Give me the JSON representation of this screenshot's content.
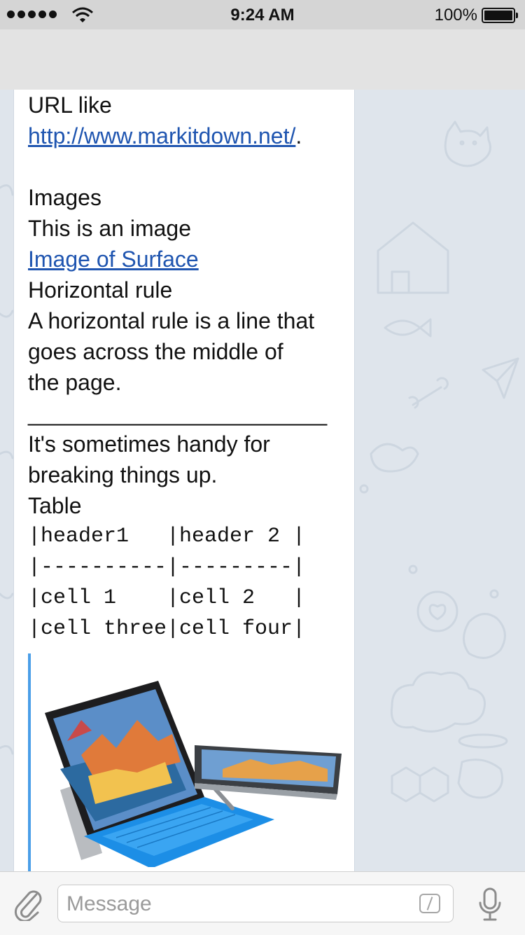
{
  "status_bar": {
    "time": "9:24 AM",
    "battery": "100%",
    "icons": [
      "signal-dots-icon",
      "wifi-icon",
      "battery-icon"
    ]
  },
  "message": {
    "url_prefix": "URL like",
    "url_link": "http://www.markitdown.net/",
    "url_suffix": ".",
    "images_heading": "Images",
    "images_text": "This is an image",
    "images_link": "Image of Surface",
    "hr_heading": "Horizontal rule",
    "hr_text_1": "A horizontal rule is a line that",
    "hr_text_2": "goes across the middle of",
    "hr_text_3": "the page.",
    "hr_line": "________________________",
    "break_text_1": "It's sometimes handy for",
    "break_text_2": "breaking things up.",
    "table_heading": "Table",
    "table_rows": [
      "|header1   |header 2 |",
      "|----------|---------|",
      "|cell 1    |cell 2   |",
      "|cell three|cell four|"
    ]
  },
  "input_bar": {
    "placeholder": "Message",
    "icons": [
      "paperclip-icon",
      "command-slash-icon",
      "microphone-icon"
    ]
  },
  "colors": {
    "link": "#1f55b0",
    "quote_bar": "#4a9ee8",
    "chat_background": "#dfe5ec"
  }
}
